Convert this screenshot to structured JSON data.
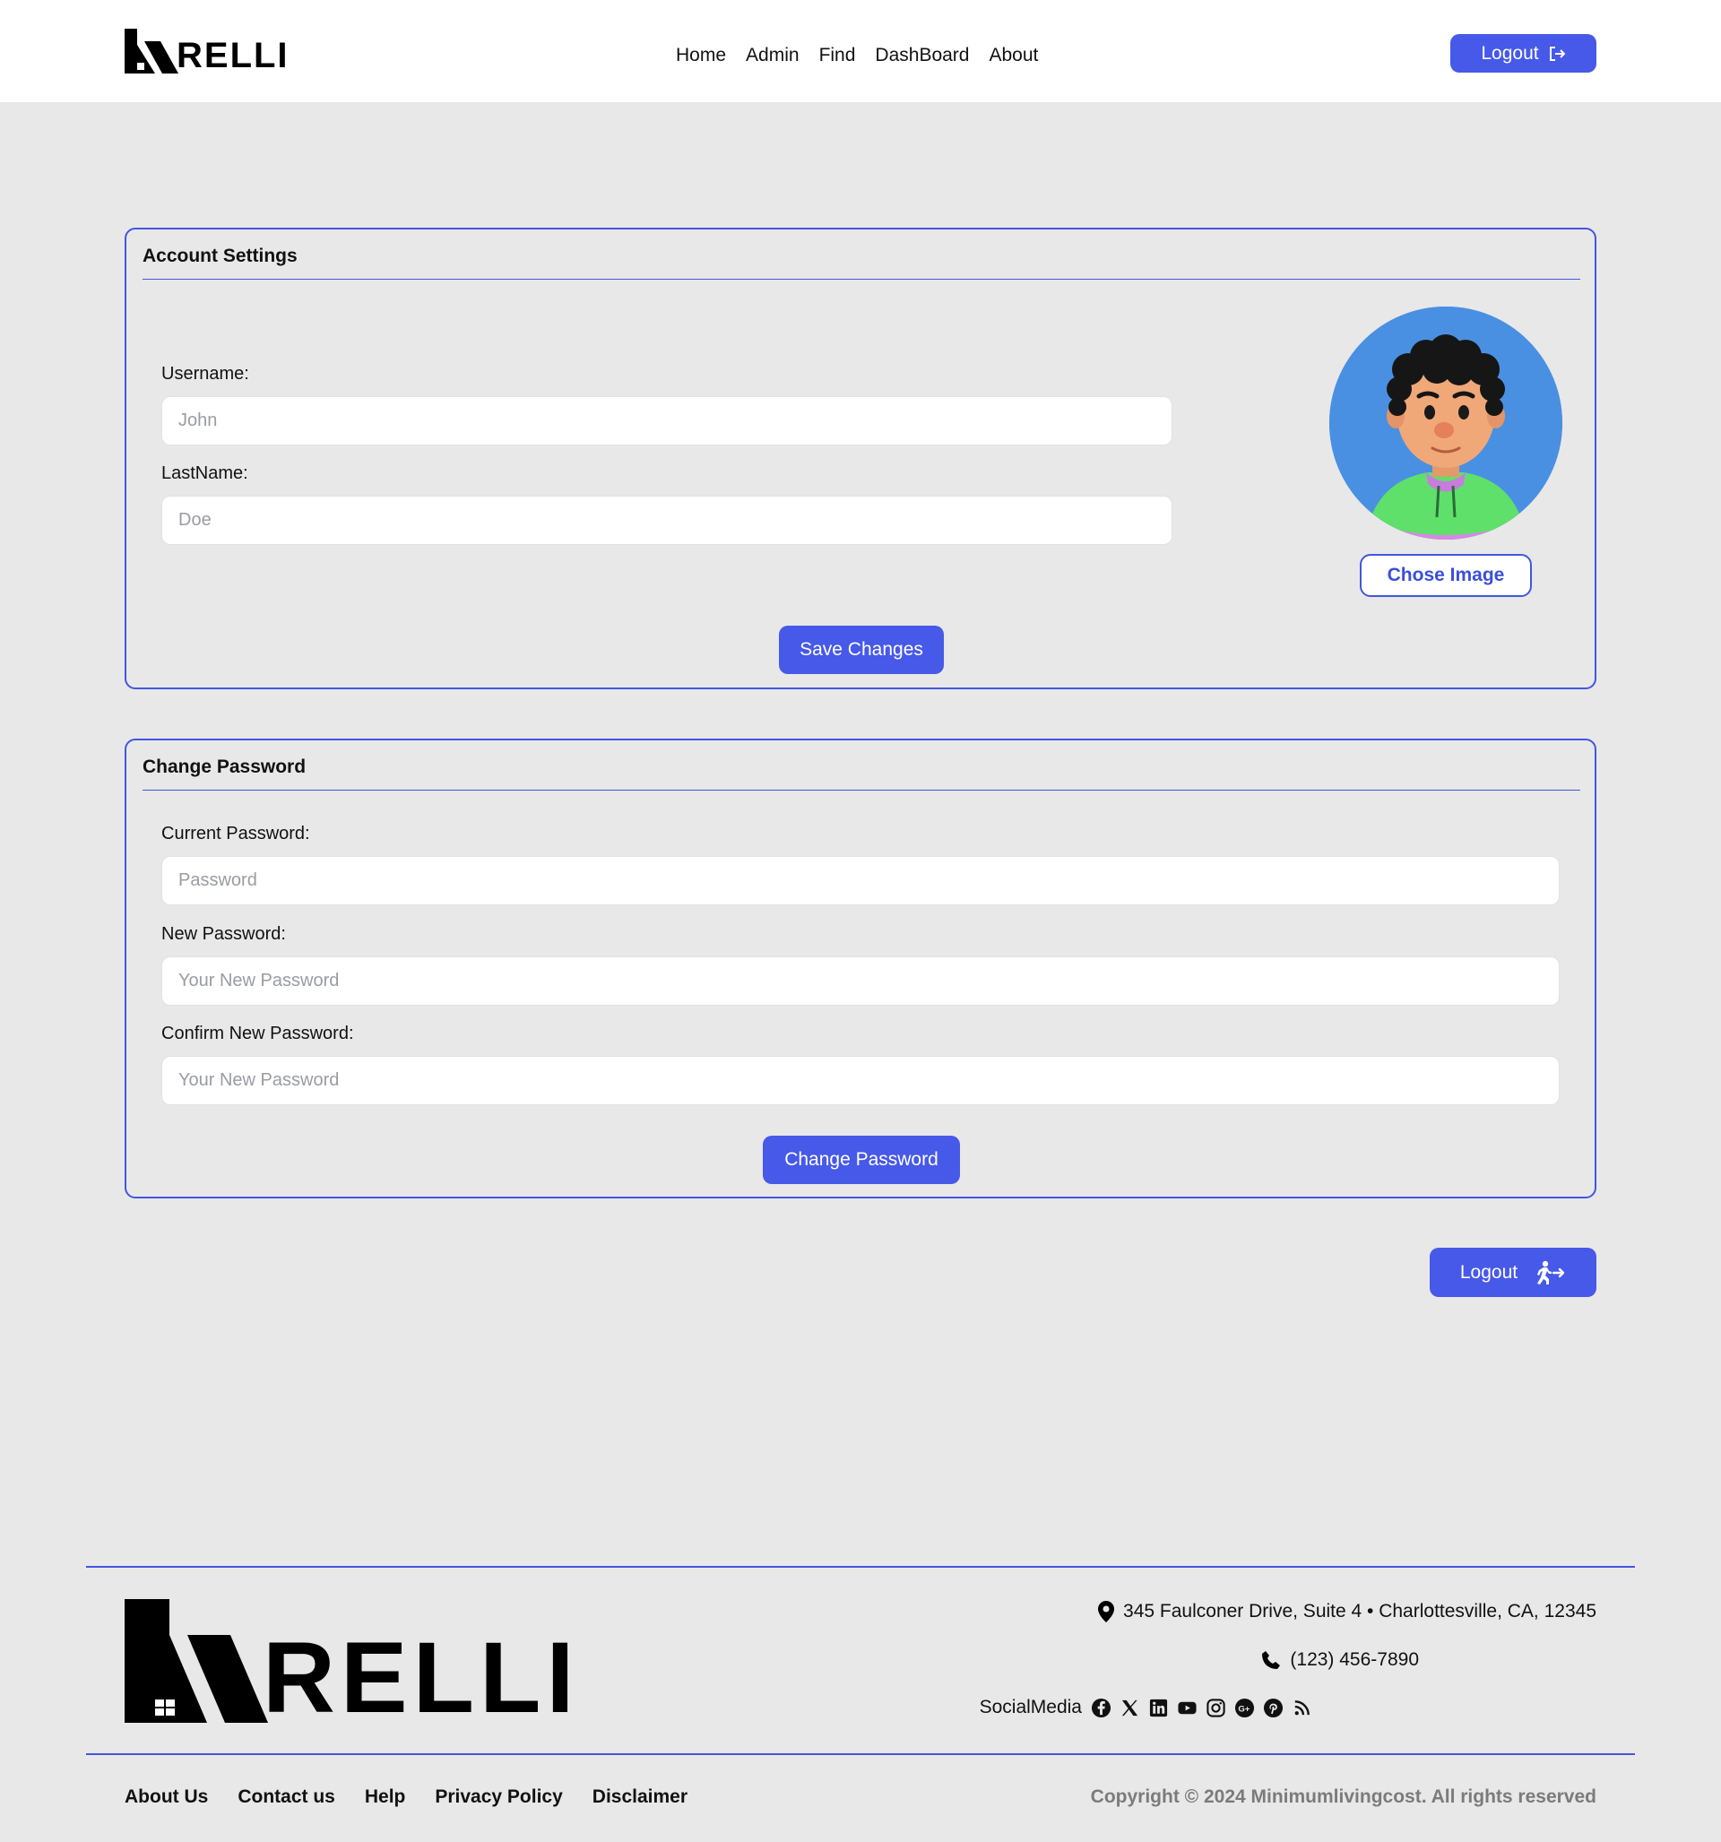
{
  "header": {
    "logo_text": "RELLI",
    "nav": [
      "Home",
      "Admin",
      "Find",
      "DashBoard",
      "About"
    ],
    "logout_label": "Logout"
  },
  "account": {
    "title": "Account Settings",
    "username_label": "Username:",
    "username_placeholder": "John",
    "lastname_label": "LastName:",
    "lastname_placeholder": "Doe",
    "choose_image_label": "Chose Image",
    "save_label": "Save Changes"
  },
  "password": {
    "title": "Change Password",
    "current_label": "Current Password:",
    "current_placeholder": "Password",
    "new_label": "New Password:",
    "new_placeholder": "Your New Password",
    "confirm_label": "Confirm New Password:",
    "confirm_placeholder": "Your New Password",
    "change_label": "Change Password"
  },
  "logout_bottom_label": "Logout",
  "footer": {
    "logo_text": "RELLI",
    "address": "345 Faulconer Drive, Suite 4 • Charlottesville, CA, 12345",
    "phone": "(123) 456-7890",
    "social_label": "SocialMedia",
    "social_icons": [
      "facebook-icon",
      "x-icon",
      "linkedin-icon",
      "youtube-icon",
      "instagram-icon",
      "google-plus-icon",
      "pinterest-icon",
      "rss-icon"
    ],
    "links": [
      "About Us",
      "Contact us",
      "Help",
      "Privacy Policy",
      "Disclaimer"
    ],
    "copyright": "Copyright © 2024 Minimumlivingcost. All rights reserved"
  },
  "colors": {
    "accent": "#4759e8",
    "border": "#4256e0",
    "background": "#e8e8e8",
    "avatar_bg": "#4a90e2"
  }
}
